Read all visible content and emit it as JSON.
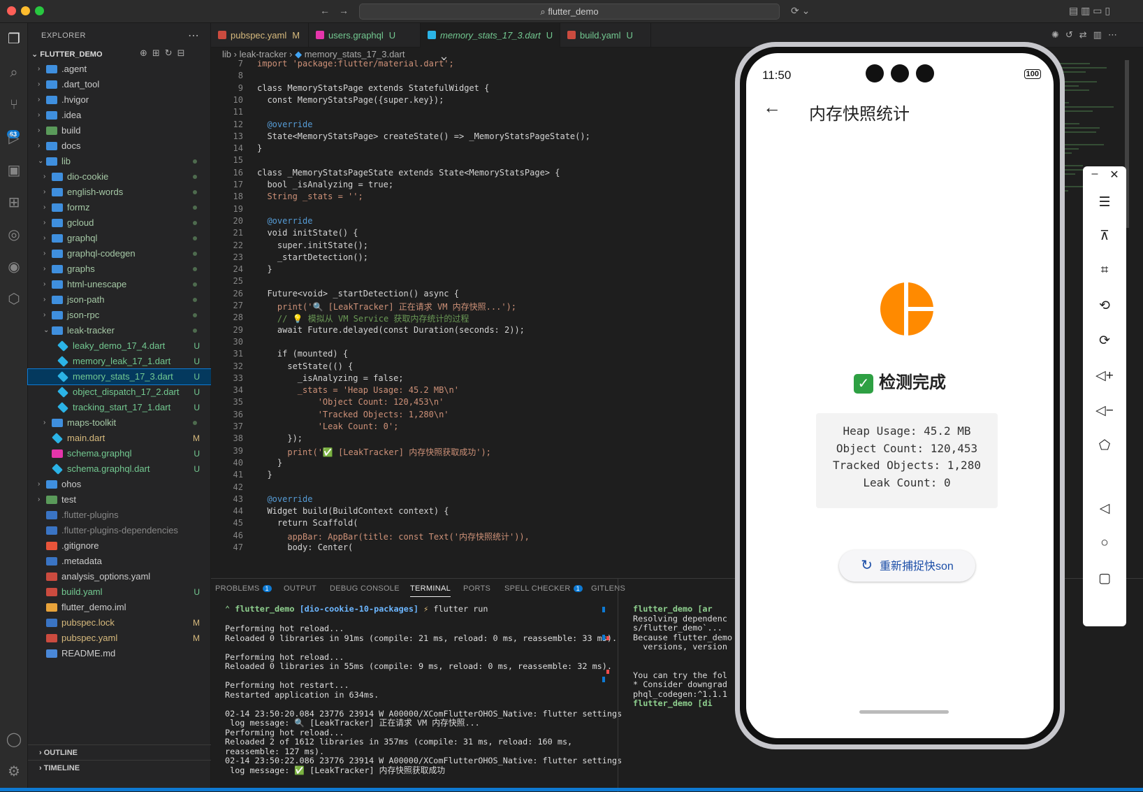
{
  "window": {
    "command_center": "flutter_demo"
  },
  "activity": {
    "scm_badge": "63"
  },
  "explorer": {
    "title": "EXPLORER",
    "root": "FLUTTER_DEMO",
    "items": [
      {
        "name": ".agent",
        "type": "folder",
        "depth": 0,
        "status": ""
      },
      {
        "name": ".dart_tool",
        "type": "folder",
        "depth": 0,
        "status": ""
      },
      {
        "name": ".hvigor",
        "type": "folder",
        "depth": 0,
        "status": ""
      },
      {
        "name": ".idea",
        "type": "folder",
        "depth": 0,
        "status": ""
      },
      {
        "name": "build",
        "type": "folder-special",
        "depth": 0,
        "status": ""
      },
      {
        "name": "docs",
        "type": "folder",
        "depth": 0,
        "status": ""
      },
      {
        "name": "lib",
        "type": "folder-open",
        "depth": 0,
        "status": "dot"
      },
      {
        "name": "dio-cookie",
        "type": "folder",
        "depth": 1,
        "status": "dot"
      },
      {
        "name": "english-words",
        "type": "folder",
        "depth": 1,
        "status": "dot"
      },
      {
        "name": "formz",
        "type": "folder",
        "depth": 1,
        "status": "dot"
      },
      {
        "name": "gcloud",
        "type": "folder",
        "depth": 1,
        "status": "dot"
      },
      {
        "name": "graphql",
        "type": "folder",
        "depth": 1,
        "status": "dot"
      },
      {
        "name": "graphql-codegen",
        "type": "folder",
        "depth": 1,
        "status": "dot"
      },
      {
        "name": "graphs",
        "type": "folder",
        "depth": 1,
        "status": "dot"
      },
      {
        "name": "html-unescape",
        "type": "folder",
        "depth": 1,
        "status": "dot"
      },
      {
        "name": "json-path",
        "type": "folder",
        "depth": 1,
        "status": "dot"
      },
      {
        "name": "json-rpc",
        "type": "folder",
        "depth": 1,
        "status": "dot"
      },
      {
        "name": "leak-tracker",
        "type": "folder-open",
        "depth": 1,
        "status": "dot"
      },
      {
        "name": "leaky_demo_17_4.dart",
        "type": "dart",
        "depth": 2,
        "status": "U"
      },
      {
        "name": "memory_leak_17_1.dart",
        "type": "dart",
        "depth": 2,
        "status": "U"
      },
      {
        "name": "memory_stats_17_3.dart",
        "type": "dart",
        "depth": 2,
        "status": "U",
        "selected": true
      },
      {
        "name": "object_dispatch_17_2.dart",
        "type": "dart",
        "depth": 2,
        "status": "U"
      },
      {
        "name": "tracking_start_17_1.dart",
        "type": "dart",
        "depth": 2,
        "status": "U"
      },
      {
        "name": "maps-toolkit",
        "type": "folder",
        "depth": 1,
        "status": "dot"
      },
      {
        "name": "main.dart",
        "type": "dart",
        "depth": 1,
        "status": "M"
      },
      {
        "name": "schema.graphql",
        "type": "graphql",
        "depth": 1,
        "status": "U"
      },
      {
        "name": "schema.graphql.dart",
        "type": "dart",
        "depth": 1,
        "status": "U"
      },
      {
        "name": "ohos",
        "type": "folder",
        "depth": 0,
        "status": ""
      },
      {
        "name": "test",
        "type": "folder-special",
        "depth": 0,
        "status": ""
      },
      {
        "name": ".flutter-plugins",
        "type": "file",
        "depth": 0,
        "status": ""
      },
      {
        "name": ".flutter-plugins-dependencies",
        "type": "file",
        "depth": 0,
        "status": ""
      },
      {
        "name": ".gitignore",
        "type": "git",
        "depth": 0,
        "status": ""
      },
      {
        "name": ".metadata",
        "type": "file",
        "depth": 0,
        "status": ""
      },
      {
        "name": "analysis_options.yaml",
        "type": "yaml",
        "depth": 0,
        "status": ""
      },
      {
        "name": "build.yaml",
        "type": "yaml",
        "depth": 0,
        "status": "U"
      },
      {
        "name": "flutter_demo.iml",
        "type": "xml",
        "depth": 0,
        "status": ""
      },
      {
        "name": "pubspec.lock",
        "type": "file",
        "depth": 0,
        "status": "M"
      },
      {
        "name": "pubspec.yaml",
        "type": "yaml",
        "depth": 0,
        "status": "M"
      },
      {
        "name": "README.md",
        "type": "md",
        "depth": 0,
        "status": ""
      }
    ],
    "outline": "OUTLINE",
    "timeline": "TIMELINE"
  },
  "tabs": [
    {
      "label": "pubspec.yaml",
      "status": "M",
      "icon": "yaml-icon"
    },
    {
      "label": "users.graphql",
      "status": "U",
      "icon": "graphql-icon"
    },
    {
      "label": "memory_stats_17_3.dart",
      "status": "U",
      "icon": "dart-icon",
      "active": true
    },
    {
      "label": "build.yaml",
      "status": "U",
      "icon": "yaml-icon"
    }
  ],
  "breadcrumbs": [
    "lib",
    "leak-tracker",
    "memory_stats_17_3.dart"
  ],
  "code": {
    "lines": [
      {
        "n": "7",
        "t": "import 'package:flutter/material.dart';"
      },
      {
        "n": "8",
        "t": ""
      },
      {
        "n": "9",
        "t": "class MemoryStatsPage extends StatefulWidget {"
      },
      {
        "n": "10",
        "t": "  const MemoryStatsPage({super.key});"
      },
      {
        "n": "11",
        "t": ""
      },
      {
        "n": "12",
        "t": "  @override"
      },
      {
        "n": "13",
        "t": "  State<MemoryStatsPage> createState() => _MemoryStatsPageState();"
      },
      {
        "n": "14",
        "t": "}"
      },
      {
        "n": "15",
        "t": ""
      },
      {
        "n": "16",
        "t": "class _MemoryStatsPageState extends State<MemoryStatsPage> {"
      },
      {
        "n": "17",
        "t": "  bool _isAnalyzing = true;"
      },
      {
        "n": "18",
        "t": "  String _stats = '';"
      },
      {
        "n": "19",
        "t": ""
      },
      {
        "n": "20",
        "t": "  @override"
      },
      {
        "n": "21",
        "t": "  void initState() {"
      },
      {
        "n": "22",
        "t": "    super.initState();"
      },
      {
        "n": "23",
        "t": "    _startDetection();"
      },
      {
        "n": "24",
        "t": "  }"
      },
      {
        "n": "25",
        "t": ""
      },
      {
        "n": "26",
        "t": "  Future<void> _startDetection() async {"
      },
      {
        "n": "27",
        "t": "    print('🔍 [LeakTracker] 正在请求 VM 内存快照...');"
      },
      {
        "n": "28",
        "t": "    // 💡 模拟从 VM Service 获取内存统计的过程"
      },
      {
        "n": "29",
        "t": "    await Future.delayed(const Duration(seconds: 2));"
      },
      {
        "n": "30",
        "t": ""
      },
      {
        "n": "31",
        "t": "    if (mounted) {"
      },
      {
        "n": "32",
        "t": "      setState(() {"
      },
      {
        "n": "33",
        "t": "        _isAnalyzing = false;"
      },
      {
        "n": "34",
        "t": "        _stats = 'Heap Usage: 45.2 MB\\n'"
      },
      {
        "n": "35",
        "t": "            'Object Count: 120,453\\n'"
      },
      {
        "n": "36",
        "t": "            'Tracked Objects: 1,280\\n'"
      },
      {
        "n": "37",
        "t": "            'Leak Count: 0';"
      },
      {
        "n": "38",
        "t": "      });"
      },
      {
        "n": "39",
        "t": "      print('✅ [LeakTracker] 内存快照获取成功');"
      },
      {
        "n": "40",
        "t": "    }"
      },
      {
        "n": "41",
        "t": "  }"
      },
      {
        "n": "42",
        "t": ""
      },
      {
        "n": "43",
        "t": "  @override"
      },
      {
        "n": "44",
        "t": "  Widget build(BuildContext context) {"
      },
      {
        "n": "45",
        "t": "    return Scaffold("
      },
      {
        "n": "46",
        "t": "      appBar: AppBar(title: const Text('内存快照统计')),"
      },
      {
        "n": "47",
        "t": "      body: Center("
      }
    ]
  },
  "panel": {
    "tabs": [
      {
        "label": "PROBLEMS",
        "badge": "1"
      },
      {
        "label": "OUTPUT",
        "badge": ""
      },
      {
        "label": "DEBUG CONSOLE",
        "badge": ""
      },
      {
        "label": "TERMINAL",
        "badge": "",
        "active": true
      },
      {
        "label": "PORTS",
        "badge": ""
      },
      {
        "label": "SPELL CHECKER",
        "badge": "1"
      },
      {
        "label": "GITLENS",
        "badge": ""
      }
    ],
    "prompt": {
      "dir": "flutter_demo",
      "branch": "[dio-cookie-10-packages]",
      "cmd": "flutter run"
    },
    "terminal": [
      "Performing hot reload...",
      "Reloaded 0 libraries in 91ms (compile: 21 ms, reload: 0 ms, reassemble: 33 ms).",
      "",
      "Performing hot reload...",
      "Reloaded 0 libraries in 55ms (compile: 9 ms, reload: 0 ms, reassemble: 32 ms).",
      "",
      "Performing hot restart...",
      "Restarted application in 634ms.",
      "",
      "02-14 23:50:20.084 23776 23914 W A00000/XComFlutterOHOS_Native: flutter settings",
      " log message: 🔍 [LeakTracker] 正在请求 VM 内存快照...",
      "Performing hot reload...",
      "Reloaded 2 of 1612 libraries in 357ms (compile: 31 ms, reload: 160 ms,",
      "reassemble: 127 ms).",
      "02-14 23:50:22.086 23776 23914 W A00000/XComFlutterOHOS_Native: flutter settings",
      " log message: ✅ [LeakTracker] 内存快照获取成功"
    ],
    "terminal2": [
      "flutter_demo [ar",
      "Resolving dependenc",
      "s/flutter_demo`...",
      "Because flutter_demo",
      "  versions, version",
      "",
      "",
      "You can try the fol",
      "* Consider downgrad",
      "phql_codegen:^1.1.1",
      "flutter_demo [di"
    ]
  },
  "phone": {
    "time": "11:50",
    "battery": "100",
    "title": "内存快照统计",
    "status": "检测完成",
    "stats": [
      "Heap Usage: 45.2 MB",
      "Object Count: 120,453",
      "Tracked Objects: 1,280",
      "Leak Count: 0"
    ],
    "button": "重新捕捉快son",
    "accent": "#ff8a00"
  },
  "colors": {
    "accent": "#0e7ad3",
    "modified": "#d7ba7d",
    "untracked": "#73c991"
  }
}
